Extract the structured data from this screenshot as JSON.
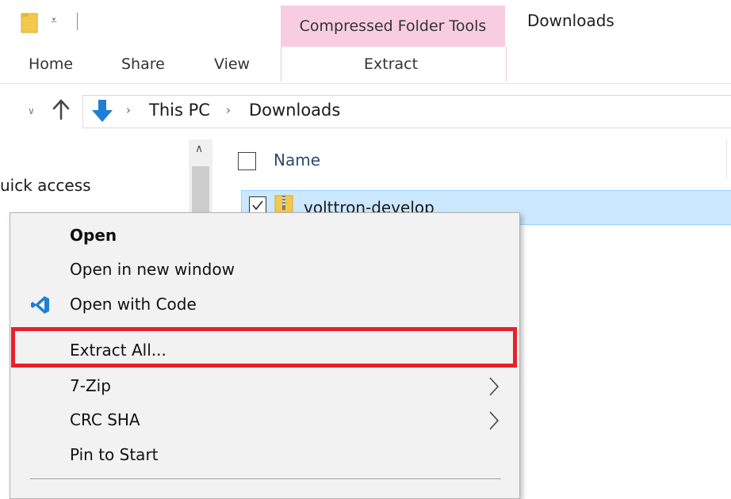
{
  "window": {
    "title": "Downloads"
  },
  "ribbon": {
    "contextual_header": "Compressed Folder Tools",
    "tabs": [
      {
        "label": "Home"
      },
      {
        "label": "Share"
      },
      {
        "label": "View"
      },
      {
        "label": "Extract"
      }
    ]
  },
  "address": {
    "crumbs": [
      "This PC",
      "Downloads"
    ],
    "separator": "›"
  },
  "nav_pane": {
    "quick_access": "uick access"
  },
  "file_list": {
    "column_name": "Name",
    "rows": [
      {
        "name": "volttron-develop",
        "selected": true
      }
    ]
  },
  "context_menu": {
    "items": [
      {
        "label": "Open",
        "bold": true
      },
      {
        "label": "Open in new window"
      },
      {
        "label": "Open with Code",
        "icon": "vscode-icon"
      },
      {
        "label": "Extract All...",
        "highlighted": true
      },
      {
        "label": "7-Zip",
        "submenu": true
      },
      {
        "label": "CRC SHA",
        "submenu": true
      },
      {
        "label": "Pin to Start"
      }
    ]
  },
  "colors": {
    "contextual_tab": "#f9cde1",
    "selection": "#cce8ff",
    "highlight_border": "#e8202a",
    "folder": "#f4c84c",
    "vscode": "#1f7fd4"
  },
  "icons": [
    "folder-icon",
    "quick-access-dropdown-icon",
    "up-arrow-icon",
    "download-arrow-icon",
    "zip-folder-icon",
    "vscode-icon",
    "chevron-right-icon"
  ]
}
